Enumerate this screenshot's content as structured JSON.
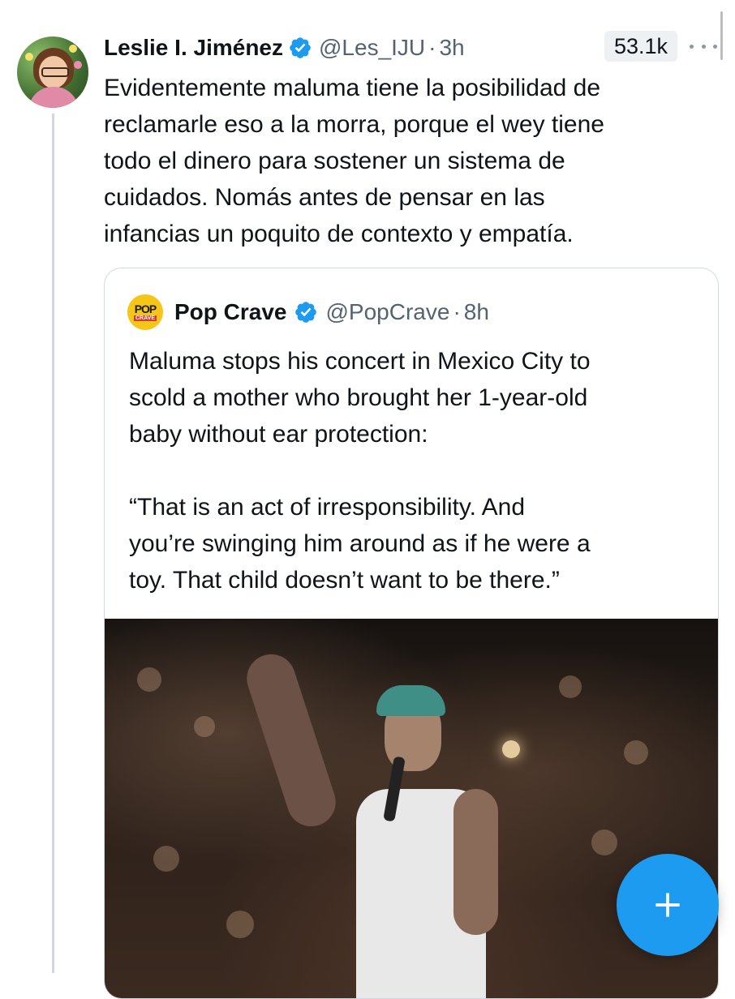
{
  "tweet": {
    "author_name": "Leslie I. Jiménez",
    "handle": "@Les_IJU",
    "separator": "·",
    "time": "3h",
    "views": "53.1k",
    "text_lines": [
      "Evidentemente maluma tiene la posibilidad de",
      "reclamarle eso a la morra, porque el wey tiene",
      "todo el dinero para sostener un sistema de",
      "cuidados. Nomás antes de pensar en las",
      "infancias un poquito de contexto y empatía."
    ],
    "avatar_icon": "user-avatar",
    "verified_icon": "verified-badge-icon",
    "verified_color": "#1d9bf0"
  },
  "quote": {
    "logo_text_top": "POP",
    "logo_text_bottom": "CRAVE",
    "author_name": "Pop Crave",
    "handle": "@PopCrave",
    "separator": "·",
    "time": "8h",
    "text_lines": [
      "Maluma stops his concert in Mexico City to",
      "scold a mother who brought her 1-year-old",
      "baby without ear protection:",
      "",
      "“That is an act of irresponsibility. And",
      "you’re swinging him around as if he were a",
      "toy. That child doesn’t want to be there.”"
    ],
    "media_icon": "concert-video-thumbnail"
  },
  "fab": {
    "icon": "plus-icon",
    "color": "#1d9bf0"
  },
  "colors": {
    "text": "#0f1419",
    "secondary": "#536471",
    "border": "#cfd9de",
    "accent": "#1d9bf0"
  }
}
